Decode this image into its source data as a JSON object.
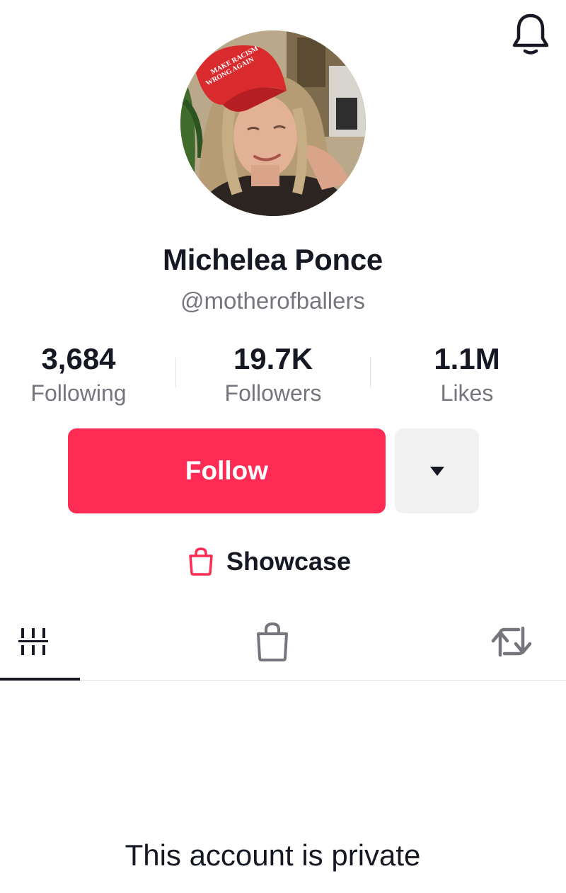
{
  "profile": {
    "display_name": "Michelea Ponce",
    "username": "@motherofballers",
    "avatar_hat_text": [
      "MAKE RACISM",
      "WRONG AGAIN"
    ]
  },
  "stats": {
    "following": {
      "value": "3,684",
      "label": "Following"
    },
    "followers": {
      "value": "19.7K",
      "label": "Followers"
    },
    "likes": {
      "value": "1.1M",
      "label": "Likes"
    }
  },
  "actions": {
    "follow_label": "Follow",
    "more_icon": "triangle-down-icon"
  },
  "showcase": {
    "label": "Showcase",
    "icon": "shopping-bag-icon"
  },
  "tabs": [
    {
      "icon": "videos-grid-icon",
      "selected": true
    },
    {
      "icon": "shopping-bag-icon",
      "selected": false
    },
    {
      "icon": "repost-icon",
      "selected": false
    }
  ],
  "content": {
    "private_message": "This account is private"
  },
  "colors": {
    "accent": "#fe2c55",
    "text_primary": "#161823",
    "text_secondary": "#75767d",
    "secondary_button_bg": "#f1f1f2"
  },
  "header": {
    "notification_icon": "bell-icon"
  }
}
